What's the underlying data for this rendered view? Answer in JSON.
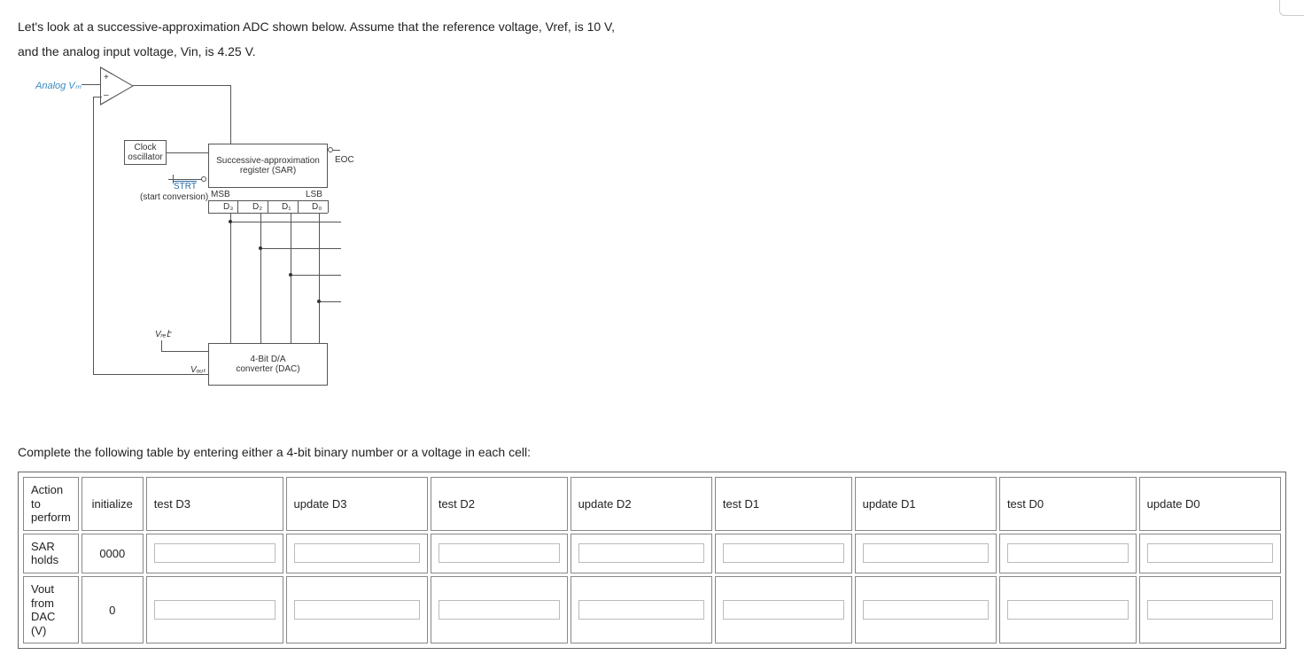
{
  "intro": {
    "line1": "Let's look at a successive-approximation ADC shown below. Assume that the reference voltage, Vref, is 10 V,",
    "line2": "and the analog input voltage, Vin, is 4.25 V."
  },
  "diagram": {
    "analog_vin": "Analog Vₘ",
    "comp_plus": "+",
    "comp_minus": "–",
    "clock_oscillator_l1": "Clock",
    "clock_oscillator_l2": "oscillator",
    "strt": "STRT",
    "strt_sub": "(start conversion)",
    "sar_l1": "Successive-approximation",
    "sar_l2": "register (SAR)",
    "eoc": "EOC",
    "msb": "MSB",
    "lsb": "LSB",
    "d3": "D₃",
    "d2": "D₂",
    "d1": "D₁",
    "d0": "D₀",
    "vref": "Vᵣₑէ",
    "vout": "Vₒᵤₜ",
    "dac_l1": "4-Bit D/A",
    "dac_l2": "converter (DAC)"
  },
  "instruction": "Complete the following table by entering either a 4-bit binary number or a voltage in each cell:",
  "table": {
    "rowheaders": {
      "action": "Action to perform",
      "sar": "SAR holds",
      "vout": "Vout from DAC (V)"
    },
    "actions": [
      "initialize",
      "test D3",
      "update D3",
      "test D2",
      "update D2",
      "test D1",
      "update D1",
      "test D0",
      "update D0"
    ],
    "init_sar": "0000",
    "init_vout": "0"
  }
}
